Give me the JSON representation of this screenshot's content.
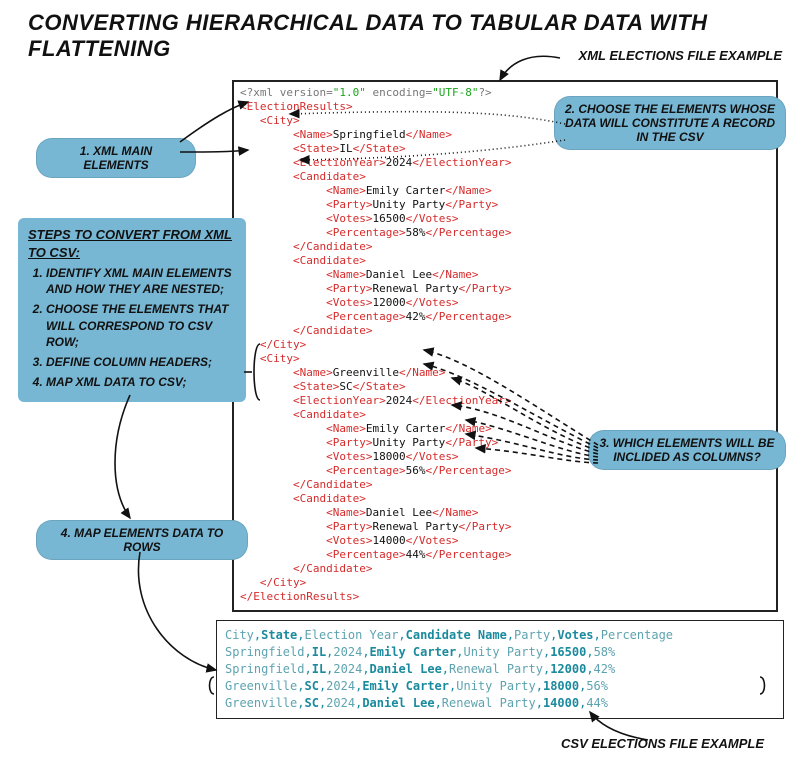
{
  "title": "CONVERTING HIERARCHICAL DATA TO TABULAR DATA WITH FLATTENING",
  "label_top": "XML ELECTIONS FILE EXAMPLE",
  "label_bottom": "CSV  ELECTIONS FILE EXAMPLE",
  "callouts": {
    "c1": "1. XML MAIN ELEMENTS",
    "c2": "2. CHOOSE THE ELEMENTS WHOSE DATA WILL CONSTITUTE A RECORD IN THE CSV",
    "c3": "3. WHICH ELEMENTS WILL BE INCLIDED AS COLUMNS?",
    "c4": "4. MAP ELEMENTS DATA TO ROWS"
  },
  "steps": {
    "title": "STEPS TO CONVERT FROM XML TO CSV:",
    "items": [
      "IDENTIFY XML MAIN ELEMENTS AND HOW THEY ARE NESTED;",
      "CHOOSE THE ELEMENTS THAT WILL CORRESPOND TO CSV ROW;",
      "DEFINE COLUMN HEADERS;",
      "MAP XML DATA TO CSV;"
    ]
  },
  "xml": {
    "decl": "<?xml version=\"1.0\" encoding=\"UTF-8\"?>",
    "root": "ElectionResults",
    "cities": [
      {
        "Name": "Springfield",
        "State": "IL",
        "ElectionYear": "2024",
        "Candidates": [
          {
            "Name": "Emily Carter",
            "Party": "Unity Party",
            "Votes": "16500",
            "Percentage": "58%"
          },
          {
            "Name": "Daniel Lee",
            "Party": "Renewal Party",
            "Votes": "12000",
            "Percentage": "42%"
          }
        ]
      },
      {
        "Name": "Greenville",
        "State": "SC",
        "ElectionYear": "2024",
        "Candidates": [
          {
            "Name": "Emily Carter",
            "Party": "Unity Party",
            "Votes": "18000",
            "Percentage": "56%"
          },
          {
            "Name": "Daniel Lee",
            "Party": "Renewal Party",
            "Votes": "14000",
            "Percentage": "44%"
          }
        ]
      }
    ]
  },
  "csv": {
    "headers": [
      "City",
      "State",
      "Election Year",
      "Candidate Name",
      "Party",
      "Votes",
      "Percentage"
    ],
    "rows": [
      [
        "Springfield",
        "IL",
        "2024",
        "Emily Carter",
        "Unity Party",
        "16500",
        "58%"
      ],
      [
        "Springfield",
        "IL",
        "2024",
        "Daniel Lee",
        "Renewal Party",
        "12000",
        "42%"
      ],
      [
        "Greenville",
        "SC",
        "2024",
        "Emily Carter",
        "Unity Party",
        "18000",
        "56%"
      ],
      [
        "Greenville",
        "SC",
        "2024",
        "Daniel Lee",
        "Renewal Party",
        "14000",
        "44%"
      ]
    ]
  }
}
